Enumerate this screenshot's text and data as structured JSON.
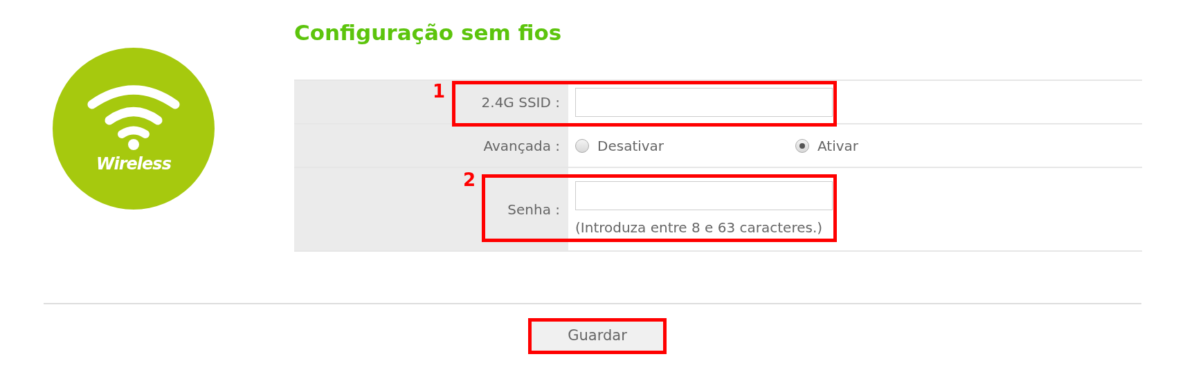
{
  "logo": {
    "caption": "Wireless"
  },
  "title": "Configuração sem fios",
  "rows": [
    {
      "kind": "text",
      "label": "2.4G SSID :",
      "value": "",
      "callout": "1"
    },
    {
      "kind": "radio",
      "label": "Avançada :",
      "options": [
        {
          "label": "Desativar",
          "selected": false
        },
        {
          "label": "Ativar",
          "selected": true
        }
      ]
    },
    {
      "kind": "password",
      "label": "Senha :",
      "hint": "(Introduza entre 8 e 63 caracteres.)",
      "callout": "2"
    }
  ],
  "save_button": {
    "label": "Guardar",
    "highlighted": true
  }
}
